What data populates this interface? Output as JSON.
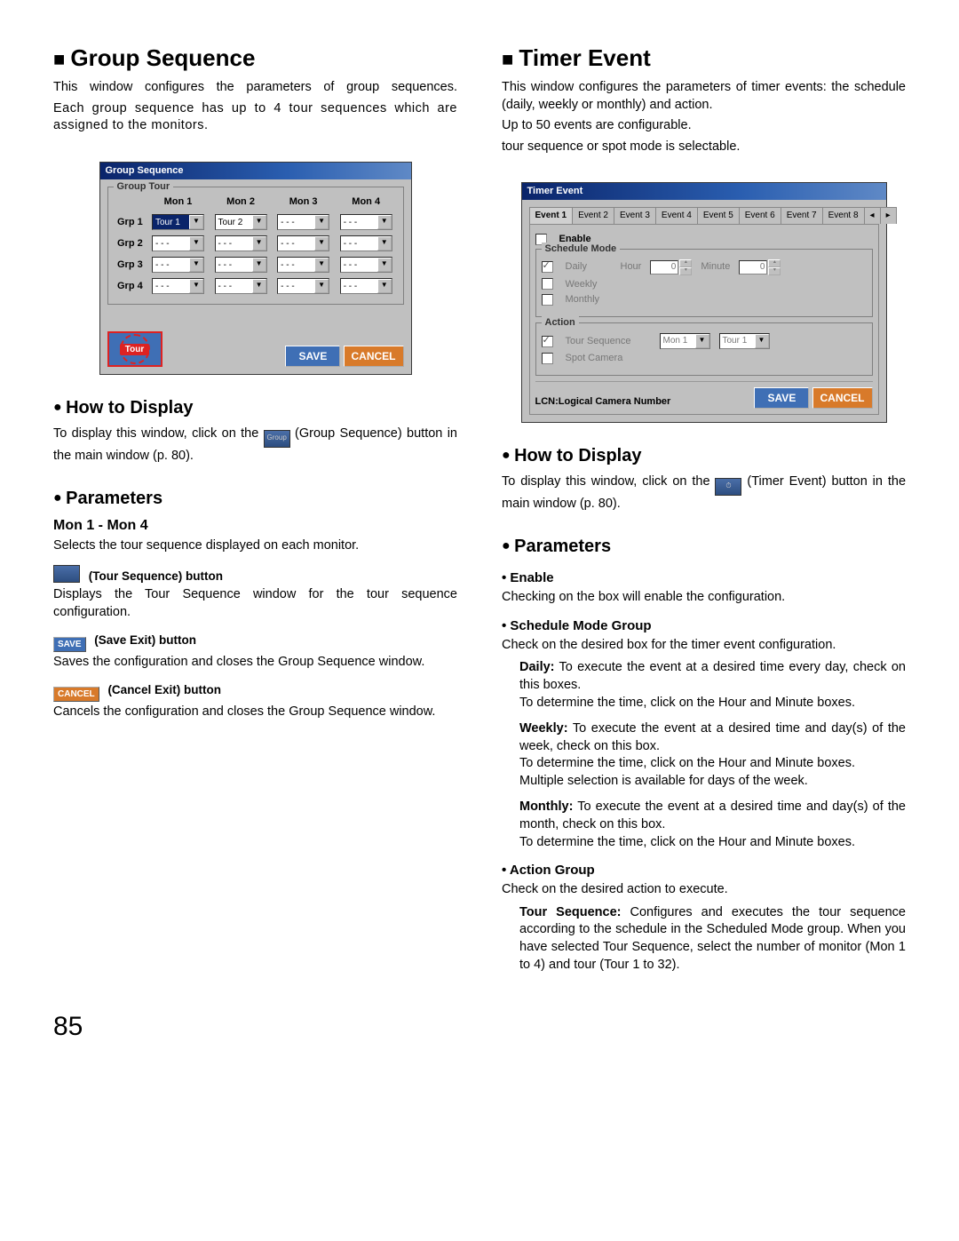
{
  "page_number": "85",
  "left": {
    "title": "Group Sequence",
    "intro1": "This window configures the parameters of group sequences.",
    "intro2": "Each group sequence has up to 4 tour sequences which are assigned to the monitors.",
    "win": {
      "title": "Group Sequence",
      "groupbox": "Group Tour",
      "cols": [
        "Mon 1",
        "Mon 2",
        "Mon 3",
        "Mon 4"
      ],
      "rows": [
        "Grp 1",
        "Grp 2",
        "Grp 3",
        "Grp 4"
      ],
      "cell_tour1": "Tour 1",
      "cell_tour2": "Tour 2",
      "cell_dash": "- - -",
      "tour_label": "Tour",
      "save": "SAVE",
      "cancel": "CANCEL"
    },
    "howto_h": "How to Display",
    "howto_a": "To display this window, click on the ",
    "howto_b": " (Group Sequence) button in the main window (p. 80).",
    "params_h": "Parameters",
    "p_mon_h": "Mon 1 - Mon 4",
    "p_mon_t": "Selects the tour sequence displayed on each monitor.",
    "p_tourbtn_h": "(Tour Sequence) button",
    "p_tourbtn_t": "Displays the Tour Sequence window for the tour sequence configuration.",
    "p_save_h": "(Save Exit) button",
    "p_save_t": "Saves the configuration and closes the Group Sequence window.",
    "minisave": "SAVE",
    "p_cancel_h": "(Cancel Exit) button",
    "p_cancel_t": "Cancels the configuration and closes the Group Sequence window.",
    "minicancel": "CANCEL"
  },
  "right": {
    "title": "Timer Event",
    "intro1": "This window configures the parameters of timer events:  the schedule (daily, weekly or monthly) and action.",
    "intro2": "Up to 50 events are configurable.",
    "intro3": "tour sequence or spot mode is selectable.",
    "win": {
      "title": "Timer Event",
      "tabs": [
        "Event 1",
        "Event 2",
        "Event 3",
        "Event 4",
        "Event 5",
        "Event 6",
        "Event 7",
        "Event 8"
      ],
      "enable": "Enable",
      "sched_box": "Schedule Mode",
      "daily": "Daily",
      "hour_l": "Hour",
      "hour_v": "0",
      "minute_l": "Minute",
      "minute_v": "0",
      "weekly": "Weekly",
      "monthly": "Monthly",
      "action_box": "Action",
      "tourseq": "Tour Sequence",
      "mon1": "Mon 1",
      "tour1": "Tour 1",
      "spot": "Spot Camera",
      "lcn": "LCN:Logical Camera Number",
      "save": "SAVE",
      "cancel": "CANCEL"
    },
    "howto_h": "How to Display",
    "howto_a": "To display this window, click on the ",
    "howto_b": " (Timer Event) button in the main window (p. 80).",
    "params_h": "Parameters",
    "p_enable_h": "Enable",
    "p_enable_t": "Checking on the box will enable the configuration.",
    "p_sched_h": "Schedule Mode Group",
    "p_sched_t": "Check on the desired box for the timer event configuration.",
    "daily_k": "Daily:",
    "daily_t": " To execute the event at a desired time every day, check on this boxes.",
    "daily_t2": "To determine the time, click on the Hour and Minute boxes.",
    "weekly_k": "Weekly:",
    "weekly_t": " To execute the event at a desired time and day(s) of the week, check on this box.",
    "weekly_t2": "To determine the time, click on the Hour and Minute boxes.",
    "weekly_t3": "Multiple selection is available for days of the week.",
    "monthly_k": "Monthly:",
    "monthly_t": " To execute the event at a desired time and day(s) of the month, check on this box.",
    "monthly_t2": "To determine the time, click on the Hour and Minute boxes.",
    "p_action_h": "Action Group",
    "p_action_t": "Check on the desired action to execute.",
    "ts_k": "Tour Sequence:",
    "ts_t": " Configures and executes the tour sequence according to the schedule in the Scheduled Mode group. When you have selected Tour Sequence, select the number of monitor (Mon 1 to 4) and tour (Tour 1 to 32)."
  }
}
